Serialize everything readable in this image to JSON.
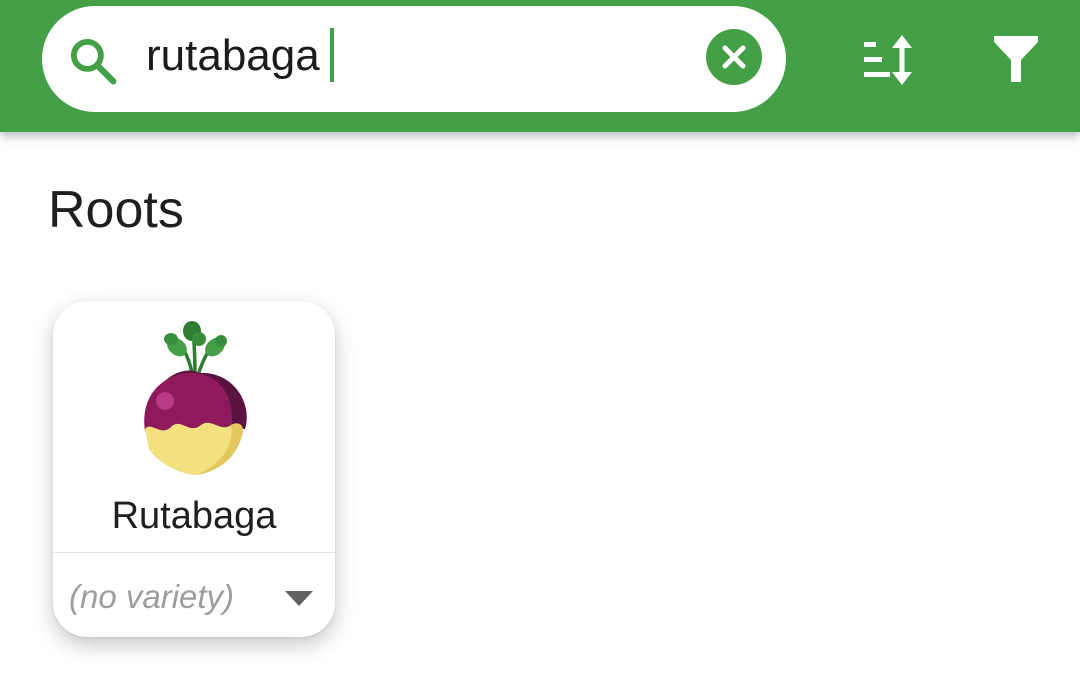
{
  "search": {
    "value": "rutabaga",
    "icon": "search-icon"
  },
  "toolbar": {
    "clear_icon": "close-circle-icon",
    "sort_icon": "sort-icon",
    "filter_icon": "filter-icon"
  },
  "colors": {
    "primary": "#43a047",
    "background": "#ffffff"
  },
  "sections": [
    {
      "title": "Roots",
      "items": [
        {
          "name": "Rutabaga",
          "image_icon": "rutabaga-icon",
          "variety": "(no variety)",
          "variety_icon": "dropdown-arrow-icon"
        }
      ]
    }
  ]
}
